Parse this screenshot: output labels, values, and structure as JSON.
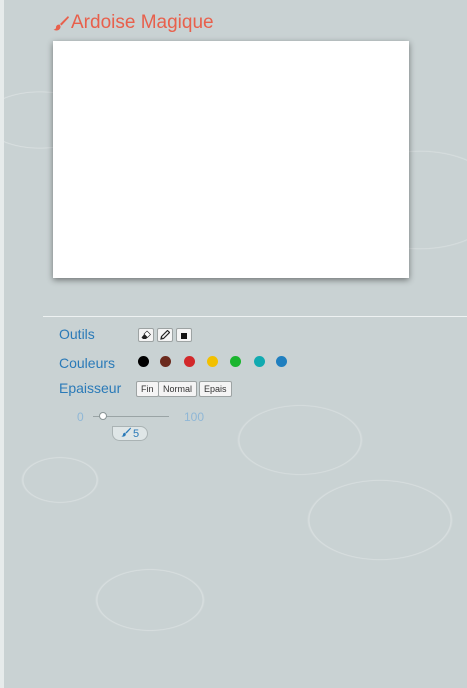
{
  "app": {
    "title": "Ardoise Magique",
    "title_color": "#e8604c"
  },
  "toolbar": {
    "tools_label": "Outils",
    "tools": [
      {
        "name": "eraser",
        "icon": "eraser-icon"
      },
      {
        "name": "pen",
        "icon": "pen-icon"
      },
      {
        "name": "fill",
        "icon": "square-icon"
      }
    ],
    "colors_label": "Couleurs",
    "colors": [
      "#000000",
      "#6b2a1d",
      "#d2282a",
      "#f2c000",
      "#1ab52e",
      "#11aab0",
      "#1f7fbf"
    ],
    "thickness_label": "Epaisseur",
    "thickness_options": [
      "Fin",
      "Normal",
      "Epais"
    ],
    "slider": {
      "min": "0",
      "max": "100",
      "value": "5",
      "value_icon": "brush-icon"
    }
  }
}
